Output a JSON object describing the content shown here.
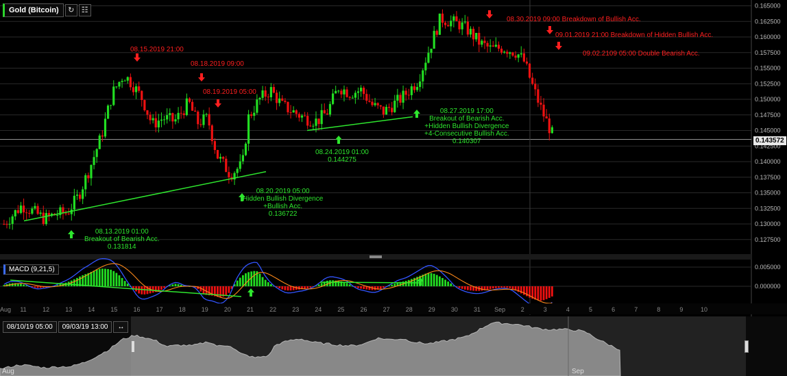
{
  "toolbar": {
    "symbol": "Gold (Bitcoin)",
    "refresh_icon": "refresh-icon",
    "settings_icon": "grid-settings-icon"
  },
  "macd_label": "MACD (9,21,5)",
  "range": {
    "start": "08/10/19  05:00",
    "end": "09/03/19  13:00",
    "expand_icon": "expand-arrows-icon"
  },
  "last_price": "0.143572",
  "annotations": {
    "a1": "08.15.2019 21:00",
    "a2": "08.18.2019 09:00",
    "a3": "08.19.2019 05:00",
    "a4": "08.30.2019 09:00 Breakdown of Bullish Acc.",
    "a5": "09.01.2019 21:00 Breakdown of Hidden Bullish Acc.",
    "a6": "09.02.2109 05:00 Double Bearish Acc.",
    "g1": [
      "08.13.2019 01:00",
      "Breakout of Bearish Acc.",
      "0.131814"
    ],
    "g2": [
      "08.20.2019 05:00",
      "Hidden Bullish Divergence",
      "+Bullish Acc.",
      "0.136722"
    ],
    "g3": [
      "08.24.2019 01:00",
      "0.144275"
    ],
    "g4": [
      "08.27.2019 17:00",
      "Breakout of Bearish Acc.",
      "+Hidden Bullish Divergence",
      "+4-Consecutive Bullish Acc.",
      "0.140307"
    ]
  },
  "nav_labels": [
    "Aug",
    "Sep"
  ],
  "chart_data": {
    "type": "candlestick",
    "y_ticks": [
      "0.127500",
      "0.130000",
      "0.132500",
      "0.135000",
      "0.137500",
      "0.140000",
      "0.142500",
      "0.145000",
      "0.147500",
      "0.150000",
      "0.152500",
      "0.155000",
      "0.157500",
      "0.160000",
      "0.162500",
      "0.165000"
    ],
    "ylim": [
      0.1255,
      0.1655
    ],
    "x_ticks": [
      "Aug",
      "11",
      "12",
      "13",
      "14",
      "15",
      "16",
      "17",
      "18",
      "19",
      "20",
      "21",
      "22",
      "23",
      "24",
      "25",
      "26",
      "27",
      "28",
      "29",
      "30",
      "31",
      "Sep",
      "2",
      "3",
      "4",
      "5",
      "6",
      "7",
      "8",
      "9",
      "10"
    ],
    "macd_ticks": [
      "0.005000",
      "0.000000"
    ],
    "close_path": [
      [
        "08-10 05",
        0.13
      ],
      [
        "08-11 00",
        0.133
      ],
      [
        "08-11 12",
        0.132
      ],
      [
        "08-12 00",
        0.1308
      ],
      [
        "08-12 12",
        0.1316
      ],
      [
        "08-13 00",
        0.1318
      ],
      [
        "08-13 12",
        0.1345
      ],
      [
        "08-14 00",
        0.139
      ],
      [
        "08-14 12",
        0.144
      ],
      [
        "08-15 00",
        0.151
      ],
      [
        "08-15 12",
        0.154
      ],
      [
        "08-15 21",
        0.1525
      ],
      [
        "08-16 08",
        0.15
      ],
      [
        "08-16 18",
        0.146
      ],
      [
        "08-17 06",
        0.147
      ],
      [
        "08-17 18",
        0.1465
      ],
      [
        "08-18 09",
        0.1495
      ],
      [
        "08-18 18",
        0.1462
      ],
      [
        "08-19 05",
        0.147
      ],
      [
        "08-19 15",
        0.141
      ],
      [
        "08-20 05",
        0.138
      ],
      [
        "08-20 18",
        0.1395
      ],
      [
        "08-21 00",
        0.147
      ],
      [
        "08-21 12",
        0.15
      ],
      [
        "08-22 00",
        0.1515
      ],
      [
        "08-22 12",
        0.149
      ],
      [
        "08-23 00",
        0.148
      ],
      [
        "08-23 12",
        0.147
      ],
      [
        "08-24 01",
        0.1465
      ],
      [
        "08-24 12",
        0.148
      ],
      [
        "08-25 00",
        0.152
      ],
      [
        "08-25 12",
        0.151
      ],
      [
        "08-26 00",
        0.1515
      ],
      [
        "08-26 12",
        0.149
      ],
      [
        "08-27 00",
        0.148
      ],
      [
        "08-27 17",
        0.15
      ],
      [
        "08-28 00",
        0.151
      ],
      [
        "08-28 12",
        0.153
      ],
      [
        "08-29 00",
        0.158
      ],
      [
        "08-29 12",
        0.163
      ],
      [
        "08-30 09",
        0.162
      ],
      [
        "08-30 18",
        0.161
      ],
      [
        "08-31 06",
        0.159
      ],
      [
        "08-31 18",
        0.158
      ],
      [
        "09-01 06",
        0.1583
      ],
      [
        "09-01 21",
        0.1575
      ],
      [
        "09-02 05",
        0.156
      ],
      [
        "09-02 14",
        0.152
      ],
      [
        "09-03 00",
        0.148
      ],
      [
        "09-03 13",
        0.1436
      ]
    ]
  }
}
